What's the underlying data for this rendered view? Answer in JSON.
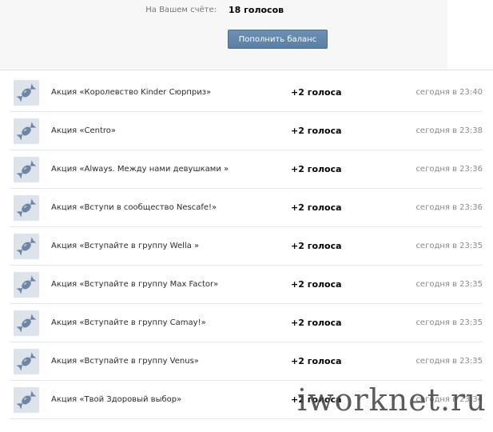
{
  "balance": {
    "label": "На Вашем счёте:",
    "value": "18 голосов",
    "topup_label": "Пополнить баланс"
  },
  "transactions": [
    {
      "name": "Акция «Королевство Kinder Сюрприз»",
      "amount": "+2 голоса",
      "time": "сегодня в 23:40"
    },
    {
      "name": "Акция «Centro»",
      "amount": "+2 голоса",
      "time": "сегодня в 23:38"
    },
    {
      "name": "Акция «Always. Между нами девушками »",
      "amount": "+2 голоса",
      "time": "сегодня в 23:36"
    },
    {
      "name": "Акция «Вступи в сообщество Nescafe!»",
      "amount": "+2 голоса",
      "time": "сегодня в 23:36"
    },
    {
      "name": "Акция «Вступайте в группу Wella »",
      "amount": "+2 голоса",
      "time": "сегодня в 23:35"
    },
    {
      "name": "Акция «Вступайте в группу Max Factor»",
      "amount": "+2 голоса",
      "time": "сегодня в 23:35"
    },
    {
      "name": "Акция «Вступайте в группу Camay!»",
      "amount": "+2 голоса",
      "time": "сегодня в 23:35"
    },
    {
      "name": "Акция «Вступайте в группу Venus»",
      "amount": "+2 голоса",
      "time": "сегодня в 23:35"
    },
    {
      "name": "Акция «Твой Здоровый выбор»",
      "amount": "+2 голоса",
      "time": "сегодня в 23:34"
    }
  ],
  "watermark": "iworknet.ru",
  "icon": "candy-icon",
  "colors": {
    "button": "#5b7fa6",
    "icon_bg": "#dde3ea",
    "icon_fg": "#6d86a3"
  }
}
